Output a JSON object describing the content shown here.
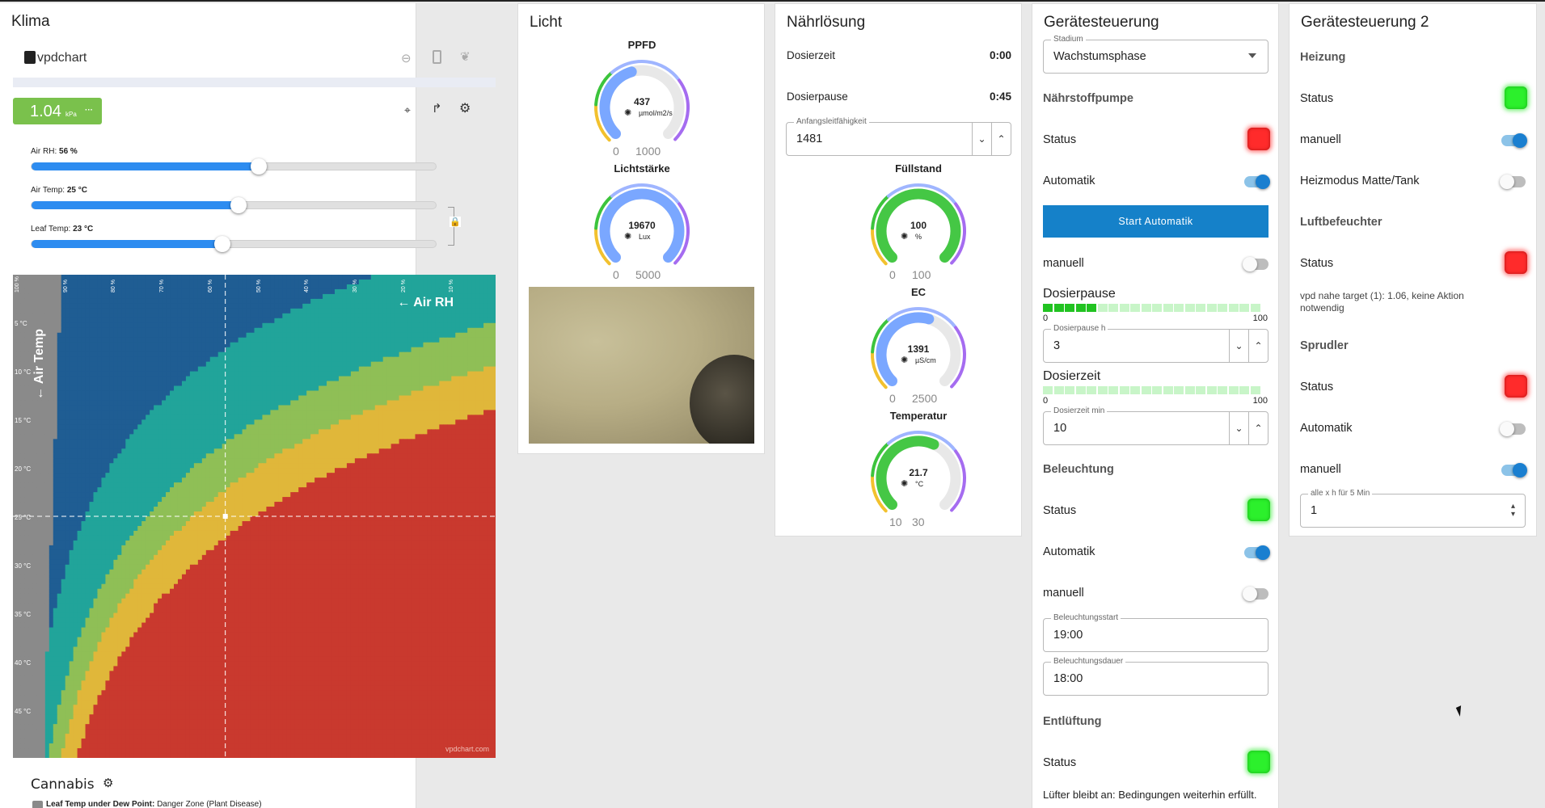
{
  "klima": {
    "title": "Klima",
    "logo": "vpdchart",
    "vpd_value": "1.04",
    "vpd_unit": "kPa",
    "vpd_more": "···",
    "sliders": [
      {
        "label": "Air RH:",
        "value": "56 %",
        "fraction": 0.56
      },
      {
        "label": "Air Temp:",
        "value": "25 °C",
        "fraction": 0.51
      },
      {
        "label": "Leaf Temp:",
        "value": "23 °C",
        "fraction": 0.47
      }
    ],
    "chart": {
      "air_rh_label": "← Air RH",
      "air_temp_label": "← Air Temp",
      "watermark": "vpdchart.com",
      "x_ticks": [
        "100 %",
        "90 %",
        "80 %",
        "70 %",
        "60 %",
        "50 %",
        "40 %",
        "30 %",
        "20 %",
        "10 %"
      ],
      "y_ticks": [
        "5 °C",
        "10 °C",
        "15 °C",
        "20 °C",
        "25 °C",
        "30 °C",
        "35 °C",
        "40 °C",
        "45 °C"
      ],
      "colors": {
        "grey": "#8a8a8a",
        "darkblue": "#1f5d93",
        "teal": "#21a49a",
        "green": "#8fbf56",
        "yellow": "#e0b73a",
        "red": "#c9392e"
      }
    },
    "preset": "Cannabis",
    "legend_bold": "Leaf Temp under Dew Point:",
    "legend_text": "Danger Zone (Plant Disease)"
  },
  "licht": {
    "title": "Licht",
    "gauges": [
      {
        "title": "PPFD",
        "value": "437",
        "unit": "µmol/m2/s",
        "min": "0",
        "max": "1000",
        "fraction": 0.44
      },
      {
        "title": "Lichtstärke",
        "value": "19670",
        "unit": "Lux",
        "min": "0",
        "max": "5000",
        "fraction": 1.0
      }
    ]
  },
  "naehr": {
    "title": "Nährlösung",
    "dosierzeit_label": "Dosierzeit",
    "dosierzeit_value": "0:00",
    "dosierpause_label": "Dosierpause",
    "dosierpause_value": "0:45",
    "leitf_label": "Anfangsleitfähigkeit",
    "leitf_value": "1481",
    "gauges": [
      {
        "title": "Füllstand",
        "value": "100",
        "unit": "%",
        "min": "0",
        "max": "100",
        "fraction": 1.0
      },
      {
        "title": "EC",
        "value": "1391",
        "unit": "µS/cm",
        "min": "0",
        "max": "2500",
        "fraction": 0.56
      },
      {
        "title": "Temperatur",
        "value": "21.7",
        "unit": "°C",
        "min": "10",
        "max": "30",
        "fraction": 0.59
      }
    ]
  },
  "geraete": {
    "title": "Gerätesteuerung",
    "stadium_label": "Stadium",
    "stadium_value": "Wachstumsphase",
    "pump_title": "Nährstoffpumpe",
    "status": "Status",
    "automatik": "Automatik",
    "manuell": "manuell",
    "start_button": "Start Automatik",
    "pause_title": "Dosierpause",
    "pause_min": "0",
    "pause_max": "100",
    "pause_fill": 0.25,
    "pause_h_label": "Dosierpause h",
    "pause_h_value": "3",
    "zeit_title": "Dosierzeit",
    "zeit_min": "0",
    "zeit_max": "100",
    "zeit_fill": 0.0,
    "zeit_min_label": "Dosierzeit min",
    "zeit_min_value": "10",
    "light_title": "Beleuchtung",
    "light_start_label": "Beleuchtungsstart",
    "light_start_value": "19:00",
    "light_dur_label": "Beleuchtungsdauer",
    "light_dur_value": "18:00",
    "vent_title": "Entlüftung",
    "vent_msg": "Lüfter bleibt an: Bedingungen weiterhin erfüllt."
  },
  "geraete2": {
    "title": "Gerätesteuerung 2",
    "heat_title": "Heizung",
    "status": "Status",
    "manuell": "manuell",
    "heat_mode": "Heizmodus Matte/Tank",
    "humid_title": "Luftbefeuchter",
    "humid_msg": "vpd nahe target (1): 1.06, keine Aktion notwendig",
    "bubbler_title": "Sprudler",
    "automatik": "Automatik",
    "interval_label": "alle x h für 5 Min",
    "interval_value": "1"
  }
}
